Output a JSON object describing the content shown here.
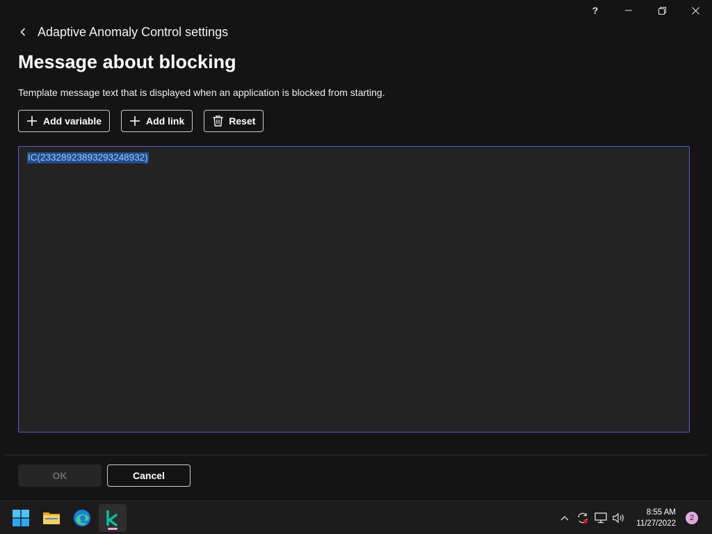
{
  "window": {
    "help_glyph": "?",
    "controls": [
      "help-icon",
      "minimize-icon",
      "restore-icon",
      "close-icon"
    ]
  },
  "breadcrumb": {
    "back_icon": "chevron-left-icon",
    "text": "Adaptive Anomaly Control settings"
  },
  "page": {
    "title": "Message about blocking",
    "description": "Template message text that is displayed when an application is blocked from starting."
  },
  "toolbar": {
    "add_variable_label": "Add variable",
    "add_link_label": "Add link",
    "reset_label": "Reset"
  },
  "editor": {
    "text": "IC(23328923893293248932)",
    "selected": true,
    "border_color": "#5a5ae0"
  },
  "footer": {
    "ok_label": "OK",
    "ok_enabled": false,
    "cancel_label": "Cancel"
  },
  "taskbar": {
    "apps": [
      "windows-start-icon",
      "file-explorer-icon",
      "edge-browser-icon",
      "kaspersky-icon"
    ],
    "active_app": "kaspersky-icon",
    "tray_icons": [
      "chevron-up-icon",
      "sync-icon",
      "network-icon",
      "volume-icon"
    ],
    "time": "8:55 AM",
    "date": "11/27/2022",
    "notification_count": "2"
  },
  "colors": {
    "background": "#141414",
    "editor_bg": "#232323",
    "accent_kaspersky": "#00a88e",
    "selection": "#1f4e8a"
  }
}
